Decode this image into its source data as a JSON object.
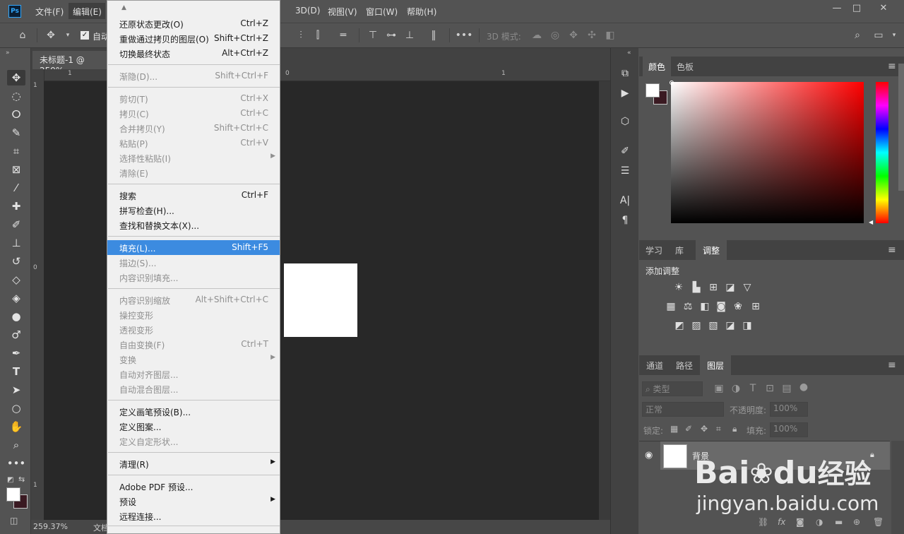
{
  "app": {
    "logo": "Ps"
  },
  "menubar": {
    "items": [
      "文件(F)",
      "编辑(E)",
      "3D(D)",
      "视图(V)",
      "窗口(W)",
      "帮助(H)"
    ]
  },
  "window_controls": {
    "minimize": "—",
    "restore": "□",
    "close": "✕"
  },
  "options": {
    "auto_select_partial": "自动",
    "mode_3d_label": "3D 模式:"
  },
  "document": {
    "tab_title": "未标题-1 @ 259%",
    "ruler_top_ticks": [
      "1",
      "0",
      "1"
    ],
    "ruler_left_ticks": [
      "1",
      "0",
      "1"
    ],
    "zoom": "259.37%",
    "status_text": "文档"
  },
  "edit_menu": {
    "items": [
      {
        "label": "还原状态更改(O)",
        "shortcut": "Ctrl+Z",
        "enabled": true
      },
      {
        "label": "重做通过拷贝的图层(O)",
        "shortcut": "Shift+Ctrl+Z",
        "enabled": true
      },
      {
        "label": "切换最终状态",
        "shortcut": "Alt+Ctrl+Z",
        "enabled": true
      },
      {
        "label": "渐隐(D)...",
        "shortcut": "Shift+Ctrl+F",
        "enabled": false
      },
      {
        "label": "剪切(T)",
        "shortcut": "Ctrl+X",
        "enabled": false
      },
      {
        "label": "拷贝(C)",
        "shortcut": "Ctrl+C",
        "enabled": false
      },
      {
        "label": "合并拷贝(Y)",
        "shortcut": "Shift+Ctrl+C",
        "enabled": false
      },
      {
        "label": "粘贴(P)",
        "shortcut": "Ctrl+V",
        "enabled": false
      },
      {
        "label": "选择性粘贴(I)",
        "shortcut": "",
        "enabled": false,
        "submenu": true
      },
      {
        "label": "清除(E)",
        "shortcut": "",
        "enabled": false
      },
      {
        "label": "搜索",
        "shortcut": "Ctrl+F",
        "enabled": true
      },
      {
        "label": "拼写检查(H)...",
        "shortcut": "",
        "enabled": true
      },
      {
        "label": "查找和替换文本(X)...",
        "shortcut": "",
        "enabled": true
      },
      {
        "label": "填充(L)...",
        "shortcut": "Shift+F5",
        "enabled": true,
        "highlighted": true
      },
      {
        "label": "描边(S)...",
        "shortcut": "",
        "enabled": false
      },
      {
        "label": "内容识别填充...",
        "shortcut": "",
        "enabled": false
      },
      {
        "label": "内容识别缩放",
        "shortcut": "Alt+Shift+Ctrl+C",
        "enabled": false
      },
      {
        "label": "操控变形",
        "shortcut": "",
        "enabled": false
      },
      {
        "label": "透视变形",
        "shortcut": "",
        "enabled": false
      },
      {
        "label": "自由变换(F)",
        "shortcut": "Ctrl+T",
        "enabled": false
      },
      {
        "label": "变换",
        "shortcut": "",
        "enabled": false,
        "submenu": true
      },
      {
        "label": "自动对齐图层...",
        "shortcut": "",
        "enabled": false
      },
      {
        "label": "自动混合图层...",
        "shortcut": "",
        "enabled": false
      },
      {
        "label": "定义画笔预设(B)...",
        "shortcut": "",
        "enabled": true
      },
      {
        "label": "定义图案...",
        "shortcut": "",
        "enabled": true
      },
      {
        "label": "定义自定形状...",
        "shortcut": "",
        "enabled": false
      },
      {
        "label": "清理(R)",
        "shortcut": "",
        "enabled": true,
        "submenu": true
      },
      {
        "label": "Adobe PDF 预设...",
        "shortcut": "",
        "enabled": true
      },
      {
        "label": "预设",
        "shortcut": "",
        "enabled": true,
        "submenu": true
      },
      {
        "label": "远程连接...",
        "shortcut": "",
        "enabled": true
      }
    ]
  },
  "color_panel": {
    "tabs": [
      "颜色",
      "色板"
    ],
    "foreground": "#ffffff",
    "background": "#3a1a22",
    "hue": "#ff0000"
  },
  "adjust_panel": {
    "tabs": [
      "学习",
      "库",
      "调整"
    ],
    "title": "添加调整"
  },
  "layers_panel": {
    "tabs": [
      "通道",
      "路径",
      "图层"
    ],
    "filter_label": "类型",
    "blend_mode": "正常",
    "opacity_label": "不透明度:",
    "opacity_value": "100%",
    "lock_label": "锁定:",
    "fill_label": "填充:",
    "fill_value": "100%",
    "layers": [
      {
        "name": "背景",
        "visible": true,
        "locked": true
      }
    ]
  },
  "watermark": {
    "brand": "Bai",
    "brand2": "du",
    "cn": "经验",
    "url": "jingyan.baidu.com"
  }
}
